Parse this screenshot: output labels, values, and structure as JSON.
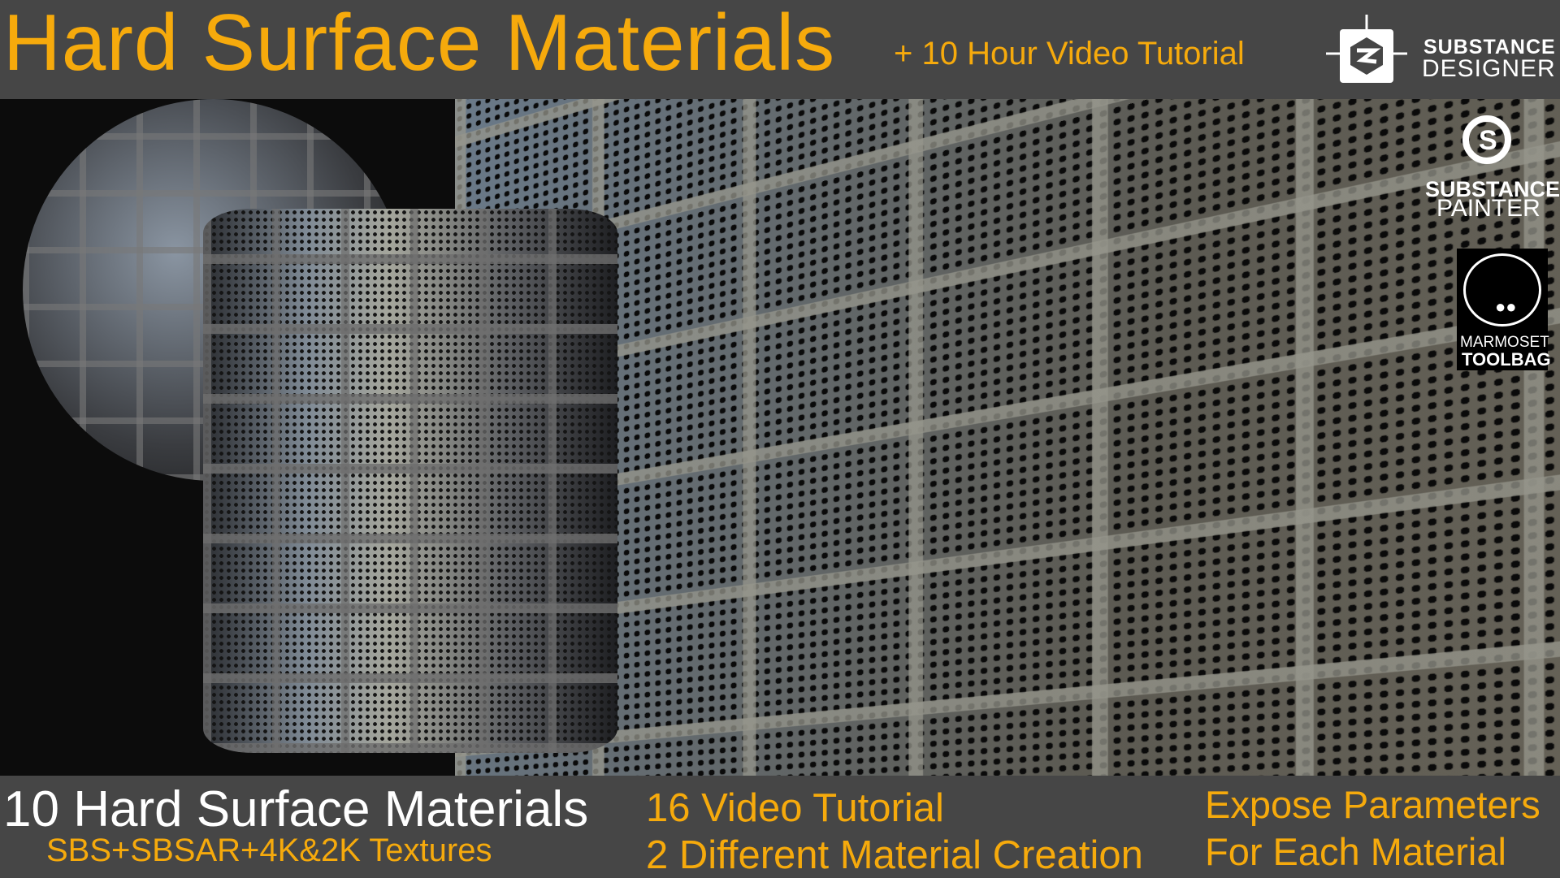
{
  "header": {
    "title": "Hard Surface Materials",
    "subtitle": "+ 10 Hour Video Tutorial"
  },
  "logos": {
    "substance_designer": {
      "line1": "SUBSTANCE",
      "line2": "DESIGNER"
    },
    "substance_painter": {
      "line1": "SUBSTANCE",
      "line2": "PAINTER"
    },
    "marmoset": {
      "line1": "MARMOSET",
      "line2": "TOOLBAG"
    }
  },
  "footer": {
    "headline": "10 Hard Surface Materials",
    "formats": "SBS+SBSAR+4K&2K Textures",
    "videos": "16 Video Tutorial",
    "creation": "2 Different Material Creation",
    "params1": "Expose Parameters",
    "params2": "For Each Material"
  },
  "colors": {
    "accent": "#f6aa0c",
    "bar": "#464646"
  }
}
